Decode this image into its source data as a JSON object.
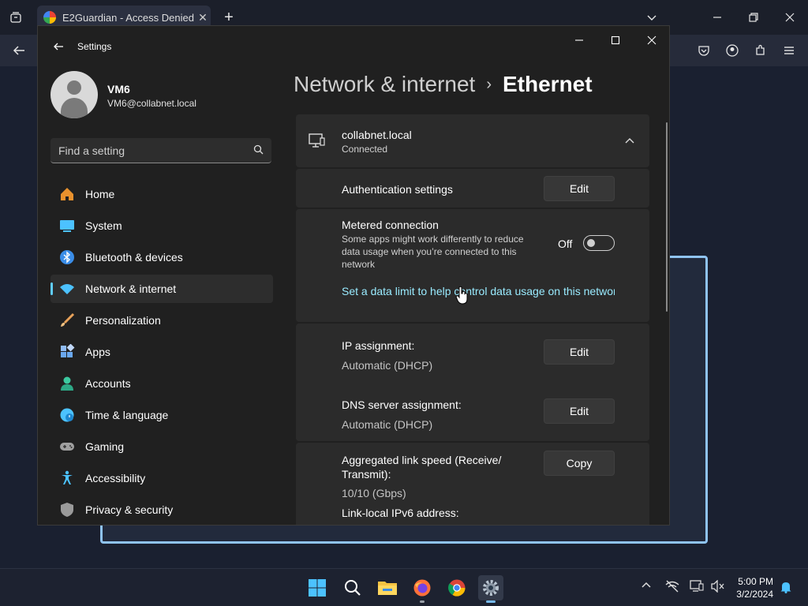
{
  "browser": {
    "tab_title": "E2Guardian - Access Denied",
    "tab_close": "✕",
    "new_tab": "+",
    "icons": [
      "tab-list-icon",
      "back-arrow-icon",
      "pocket-icon",
      "account-icon",
      "extensions-icon",
      "menu-icon"
    ]
  },
  "window": {
    "title": "Settings",
    "minimize": "—",
    "maximize": "☐",
    "close": "✕"
  },
  "user": {
    "name": "VM6",
    "email": "VM6@collabnet.local"
  },
  "search": {
    "placeholder": "Find a setting"
  },
  "nav": {
    "items": [
      {
        "label": "Home",
        "icon": "home-icon",
        "color": "#e8912d"
      },
      {
        "label": "System",
        "icon": "system-icon",
        "color": "#4cc2ff"
      },
      {
        "label": "Bluetooth & devices",
        "icon": "bluetooth-icon",
        "color": "#3a8de8"
      },
      {
        "label": "Network & internet",
        "icon": "wifi-icon",
        "color": "#4cc2ff",
        "selected": true
      },
      {
        "label": "Personalization",
        "icon": "brush-icon",
        "color": "#e8a25a"
      },
      {
        "label": "Apps",
        "icon": "apps-icon",
        "color": "#6aa8f0"
      },
      {
        "label": "Accounts",
        "icon": "accounts-icon",
        "color": "#3cc9a0"
      },
      {
        "label": "Time & language",
        "icon": "globe-icon",
        "color": "#4cc2ff"
      },
      {
        "label": "Gaming",
        "icon": "gamepad-icon",
        "color": "#a0a0a0"
      },
      {
        "label": "Accessibility",
        "icon": "accessibility-icon",
        "color": "#4cc2ff"
      },
      {
        "label": "Privacy & security",
        "icon": "shield-icon",
        "color": "#9a9a9a"
      }
    ]
  },
  "breadcrumb": {
    "parent": "Network & internet",
    "separator": "›",
    "current": "Ethernet"
  },
  "ethernet": {
    "network_name": "collabnet.local",
    "network_status": "Connected",
    "auth_label": "Authentication settings",
    "auth_button": "Edit",
    "metered_label": "Metered connection",
    "metered_desc": "Some apps might work differently to reduce data usage when you’re connected to this network",
    "metered_state": "Off",
    "metered_on": false,
    "data_limit_link": "Set a data limit to help control data usage on this network",
    "ip_label": "IP assignment:",
    "ip_value": "Automatic (DHCP)",
    "ip_button": "Edit",
    "dns_label": "DNS server assignment:",
    "dns_value": "Automatic (DHCP)",
    "dns_button": "Edit",
    "speed_label": "Aggregated link speed (Receive/ Transmit):",
    "speed_value": "10/10 (Gbps)",
    "copy_button": "Copy",
    "ipv6_label": "Link-local IPv6 address:"
  },
  "taskbar": {
    "apps": [
      "start-icon",
      "search-icon",
      "file-explorer-icon",
      "firefox-icon",
      "chrome-icon",
      "settings-icon"
    ],
    "time": "5:00 PM",
    "date": "3/2/2024"
  },
  "colors": {
    "accent": "#60cdff",
    "link": "#99ebff",
    "window_bg": "#202020",
    "card_bg": "#2b2b2b"
  }
}
